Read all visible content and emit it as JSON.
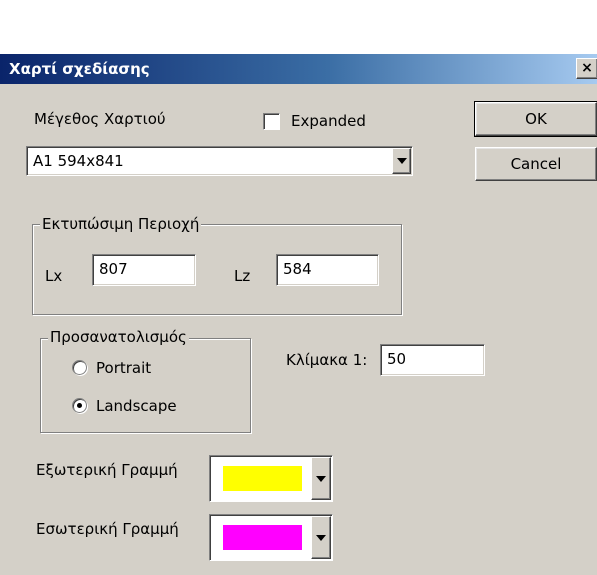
{
  "dialog": {
    "title": "Χαρτί σχεδίασης",
    "close_label": "×"
  },
  "paper": {
    "size_label": "Μέγεθος Χαρτιού",
    "size_value": "A1 594x841",
    "expanded_label": "Expanded",
    "expanded_checked": false
  },
  "buttons": {
    "ok_label": "OK",
    "cancel_label": "Cancel"
  },
  "printable_area": {
    "group_label": "Εκτυπώσιμη Περιοχή",
    "lx_label": "Lx",
    "lx_value": "807",
    "lz_label": "Lz",
    "lz_value": "584"
  },
  "orientation": {
    "group_label": "Προσανατολισμός",
    "portrait_label": "Portrait",
    "landscape_label": "Landscape",
    "selected": "Landscape"
  },
  "scale": {
    "label": "Κλίμακα 1:",
    "value": "50"
  },
  "outer_line": {
    "label": "Εξωτερική Γραμμή",
    "color": "#ffff00"
  },
  "inner_line": {
    "label": "Εσωτερική Γραμμή",
    "color": "#ff00ff"
  }
}
